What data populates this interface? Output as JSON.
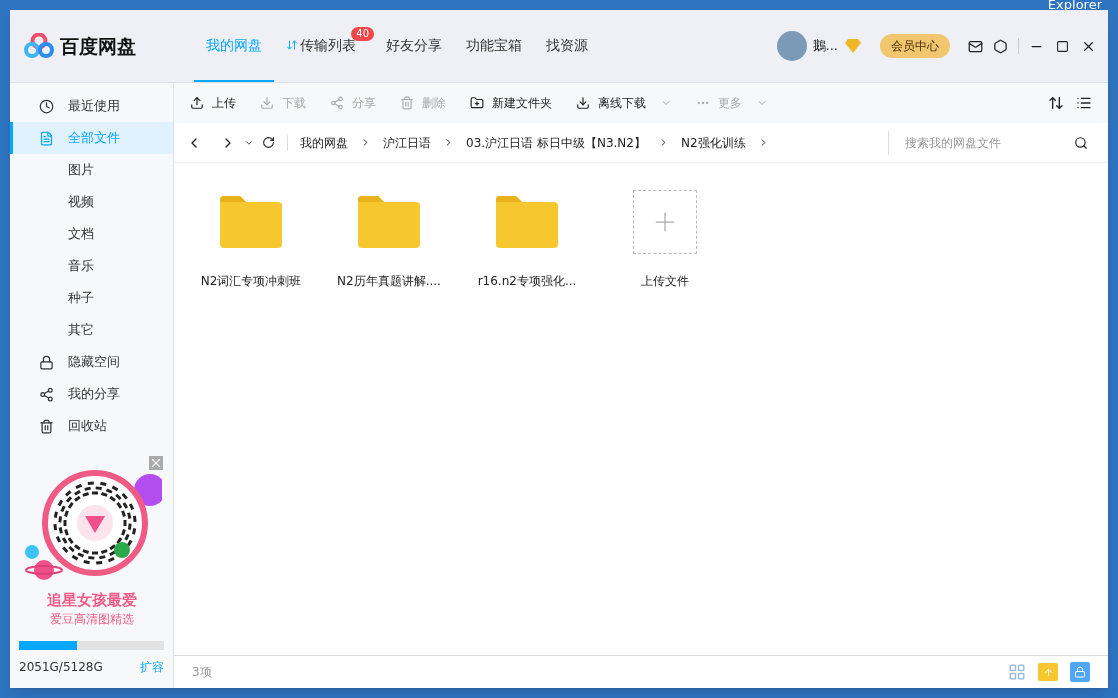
{
  "desktop": {
    "label": "Explorer"
  },
  "header": {
    "logo": "百度网盘",
    "tabs": [
      {
        "label": "我的网盘",
        "selected": true
      },
      {
        "label": "传输列表",
        "selected": false,
        "badge": "40"
      },
      {
        "label": "好友分享",
        "selected": false
      },
      {
        "label": "功能宝箱",
        "selected": false
      },
      {
        "label": "找资源",
        "selected": false
      }
    ],
    "user": {
      "name": "鵝..."
    },
    "vip_button": "会员中心"
  },
  "sidebar": {
    "items": [
      {
        "label": "最近使用",
        "kind": "main",
        "selected": false
      },
      {
        "label": "全部文件",
        "kind": "main",
        "selected": true
      },
      {
        "label": "图片",
        "kind": "sub",
        "selected": false
      },
      {
        "label": "视频",
        "kind": "sub",
        "selected": false
      },
      {
        "label": "文档",
        "kind": "sub",
        "selected": false
      },
      {
        "label": "音乐",
        "kind": "sub",
        "selected": false
      },
      {
        "label": "种子",
        "kind": "sub",
        "selected": false
      },
      {
        "label": "其它",
        "kind": "sub",
        "selected": false
      },
      {
        "label": "隐藏空间",
        "kind": "main",
        "selected": false
      },
      {
        "label": "我的分享",
        "kind": "main",
        "selected": false
      },
      {
        "label": "回收站",
        "kind": "main",
        "selected": false
      }
    ],
    "promo": {
      "title": "追星女孩最爱",
      "subtitle": "爱豆高清图精选"
    },
    "storage": {
      "level": 0.4,
      "usage": "2051G/5128G",
      "expand": "扩容"
    }
  },
  "toolbar": {
    "buttons": [
      {
        "label": "上传",
        "disabled": false,
        "dropdown": false
      },
      {
        "label": "下载",
        "disabled": true,
        "dropdown": false
      },
      {
        "label": "分享",
        "disabled": true,
        "dropdown": false
      },
      {
        "label": "删除",
        "disabled": true,
        "dropdown": false
      },
      {
        "label": "新建文件夹",
        "disabled": false,
        "dropdown": false
      },
      {
        "label": "离线下载",
        "disabled": false,
        "dropdown": true
      },
      {
        "label": "更多",
        "disabled": true,
        "dropdown": true
      }
    ]
  },
  "breadcrumb": [
    "我的网盘",
    "沪江日语",
    "03.沪江日语 标日中级【N3.N2】",
    "N2强化训练"
  ],
  "search": {
    "placeholder": "搜索我的网盘文件"
  },
  "files": [
    {
      "name": "N2词汇专项冲刺班",
      "kind": "folder"
    },
    {
      "name": "N2历年真题讲解....",
      "kind": "folder"
    },
    {
      "name": "r16.n2专项强化...",
      "kind": "folder"
    },
    {
      "name": "上传文件",
      "kind": "upload"
    }
  ],
  "status_bar": {
    "count": "3项"
  }
}
